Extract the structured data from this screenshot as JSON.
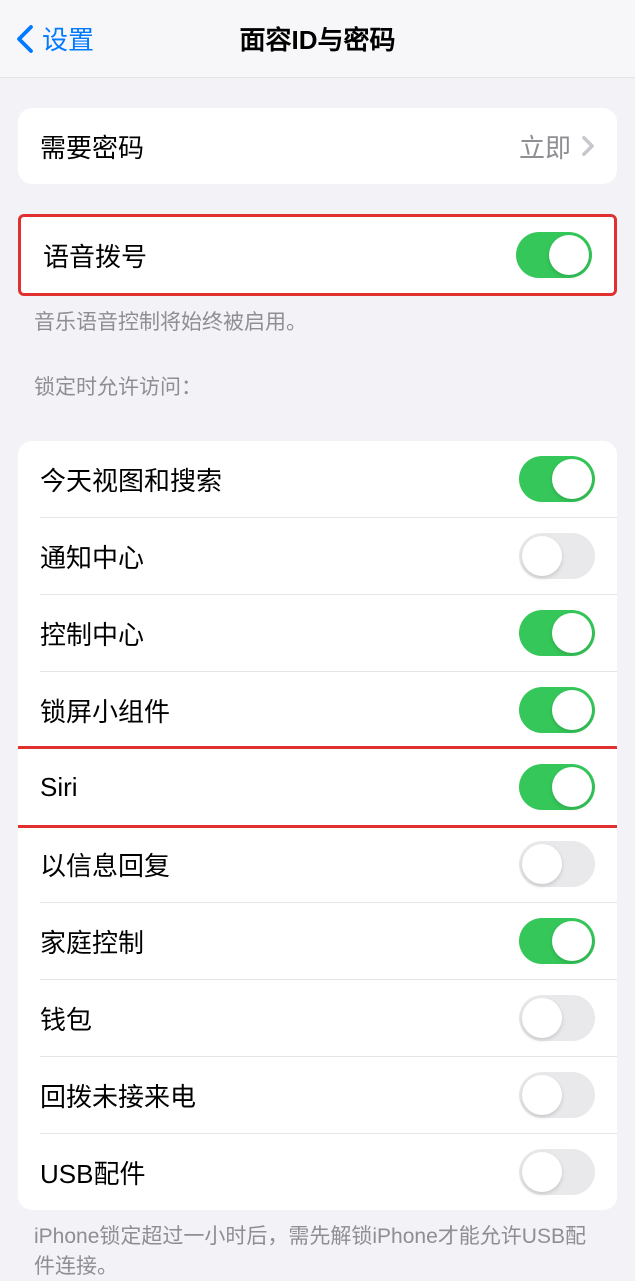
{
  "header": {
    "back_label": "设置",
    "title": "面容ID与密码"
  },
  "require_passcode": {
    "label": "需要密码",
    "value": "立即"
  },
  "voice_dial": {
    "label": "语音拨号",
    "on": true,
    "footer": "音乐语音控制将始终被启用。"
  },
  "lock_screen_access": {
    "header": "锁定时允许访问：",
    "items": [
      {
        "label": "今天视图和搜索",
        "on": true
      },
      {
        "label": "通知中心",
        "on": false
      },
      {
        "label": "控制中心",
        "on": true
      },
      {
        "label": "锁屏小组件",
        "on": true
      },
      {
        "label": "Siri",
        "on": true
      },
      {
        "label": "以信息回复",
        "on": false
      },
      {
        "label": "家庭控制",
        "on": true
      },
      {
        "label": "钱包",
        "on": false
      },
      {
        "label": "回拨未接来电",
        "on": false
      },
      {
        "label": "USB配件",
        "on": false
      }
    ],
    "footer": "iPhone锁定超过一小时后，需先解锁iPhone才能允许USB配件连接。"
  }
}
